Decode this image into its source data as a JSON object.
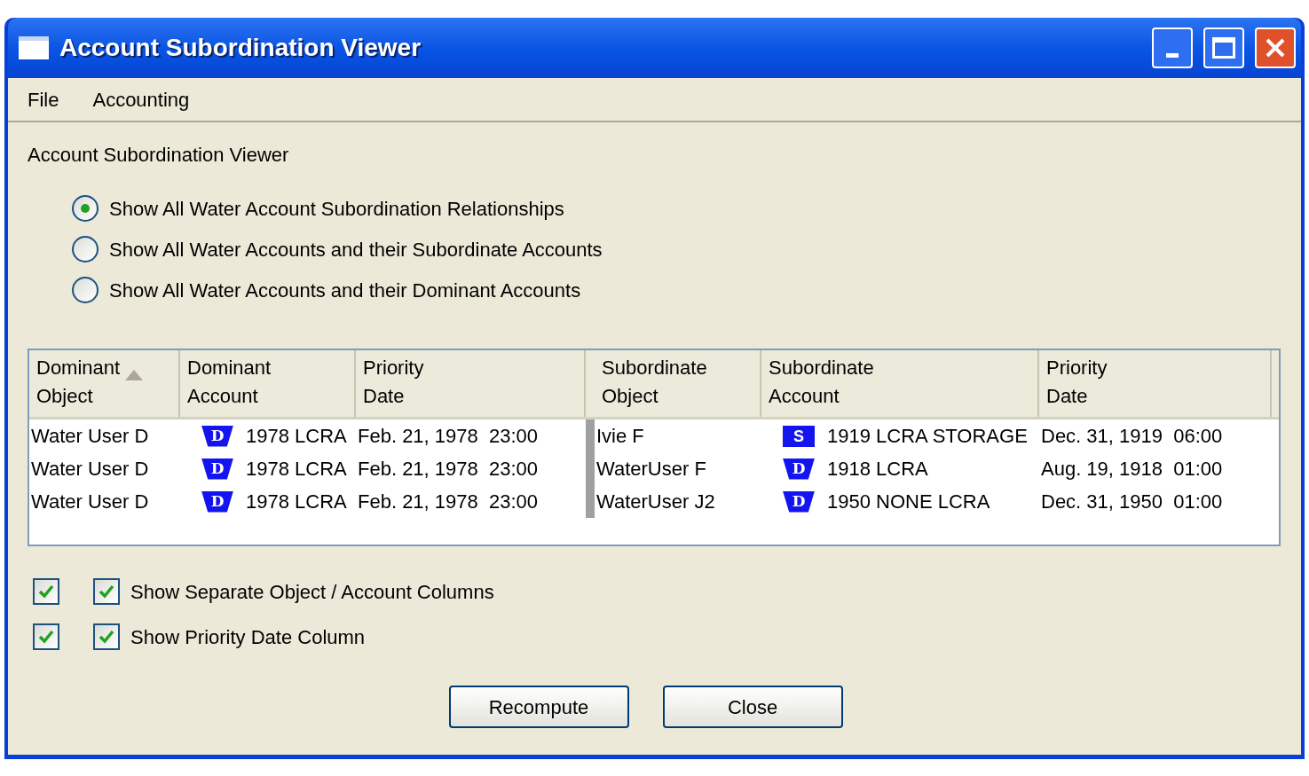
{
  "window": {
    "title": "Account Subordination Viewer"
  },
  "menu": [
    "File",
    "Accounting"
  ],
  "panel_title": "Account Subordination Viewer",
  "radios": [
    {
      "label": "Show All Water Account Subordination Relationships",
      "selected": true
    },
    {
      "label": "Show All Water Accounts and their Subordinate Accounts",
      "selected": false
    },
    {
      "label": "Show All Water Accounts and their Dominant Accounts",
      "selected": false
    }
  ],
  "table": {
    "columns": [
      {
        "lines": [
          "Dominant",
          "Object"
        ],
        "sorted": true
      },
      {
        "lines": [
          "Dominant",
          "Account"
        ],
        "sorted": false
      },
      {
        "lines": [
          "Priority",
          "Date"
        ],
        "sorted": false
      },
      {
        "lines": [
          "Subordinate",
          "Object"
        ],
        "sorted": false
      },
      {
        "lines": [
          "Subordinate",
          "Account"
        ],
        "sorted": false
      },
      {
        "lines": [
          "Priority",
          "Date"
        ],
        "sorted": false
      }
    ],
    "rows": [
      {
        "dominant_object": "Water User D",
        "dominant_account": {
          "kind": "keystone",
          "badge": "D",
          "name": "1978 LCRA"
        },
        "dominant_date": "Feb. 21, 1978  23:00",
        "subordinate_object": "Ivie F",
        "subordinate_account": {
          "kind": "square",
          "badge": "S",
          "name": "1919 LCRA STORAGE"
        },
        "subordinate_date": "Dec. 31, 1919  06:00"
      },
      {
        "dominant_object": "Water User D",
        "dominant_account": {
          "kind": "keystone",
          "badge": "D",
          "name": "1978 LCRA"
        },
        "dominant_date": "Feb. 21, 1978  23:00",
        "subordinate_object": "WaterUser F",
        "subordinate_account": {
          "kind": "keystone",
          "badge": "D",
          "name": "1918 LCRA"
        },
        "subordinate_date": "Aug. 19, 1918  01:00"
      },
      {
        "dominant_object": "Water User D",
        "dominant_account": {
          "kind": "keystone",
          "badge": "D",
          "name": "1978 LCRA"
        },
        "dominant_date": "Feb. 21, 1978  23:00",
        "subordinate_object": "WaterUser J2",
        "subordinate_account": {
          "kind": "keystone",
          "badge": "D",
          "name": "1950 NONE LCRA"
        },
        "subordinate_date": "Dec. 31, 1950  01:00"
      }
    ]
  },
  "options": [
    {
      "toggle_checked": true,
      "label": "Show Separate Object / Account Columns",
      "checked": true
    },
    {
      "toggle_checked": true,
      "label": "Show Priority Date Column",
      "checked": true
    }
  ],
  "buttons": [
    "Recompute",
    "Close"
  ]
}
